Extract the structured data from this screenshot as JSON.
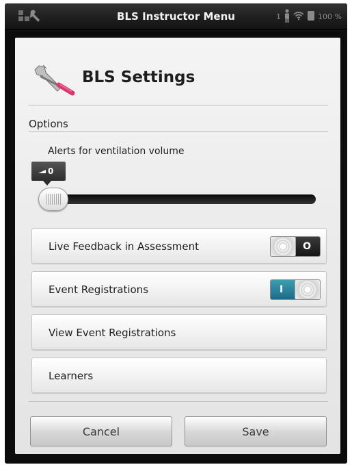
{
  "statusbar": {
    "title": "BLS Instructor Menu",
    "user_count": "1",
    "battery": "100 %",
    "left_icon": "tools-icon"
  },
  "header": {
    "title": "BLS Settings",
    "icon": "wrench-screwdriver-icon"
  },
  "options": {
    "section_label": "Options",
    "ventilation_slider": {
      "label": "Alerts for ventilation volume",
      "value": "0",
      "level": 0
    }
  },
  "rows": [
    {
      "label": "Live Feedback in Assessment",
      "toggle": {
        "state": "off",
        "text": "O"
      }
    },
    {
      "label": "Event Registrations",
      "toggle": {
        "state": "on",
        "text": "I"
      }
    },
    {
      "label": "View Event Registrations"
    },
    {
      "label": "Learners"
    }
  ],
  "footer": {
    "cancel_label": "Cancel",
    "save_label": "Save"
  },
  "colors": {
    "toggle_on": "#2a86a3",
    "toggle_off": "#1a1a1a",
    "status_bar": "#1f1f1f",
    "screwdriver_handle": "#d43a6a"
  }
}
